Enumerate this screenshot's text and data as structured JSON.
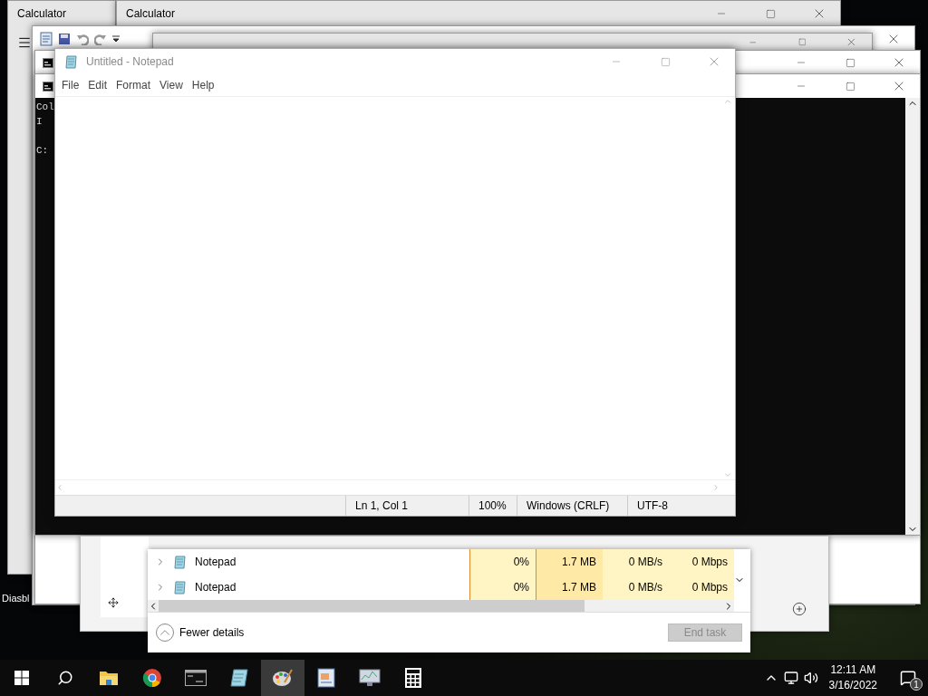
{
  "desktop": {
    "icon_label": "Diasbl"
  },
  "back_windows": [
    {
      "kind": "calculator",
      "title": "Calculator"
    },
    {
      "kind": "calculator",
      "title": "Calculator"
    },
    {
      "kind": "wordpad"
    },
    {
      "kind": "calculator"
    },
    {
      "kind": "console"
    },
    {
      "kind": "console",
      "lines": [
        "Col",
        "I"
      ],
      "prompt": "C:"
    }
  ],
  "task_manager": {
    "rows": [
      {
        "name": "Notepad",
        "cpu": "0%",
        "memory": "1.7 MB",
        "disk": "0 MB/s",
        "network": "0 Mbps"
      },
      {
        "name": "Notepad",
        "cpu": "0%",
        "memory": "1.7 MB",
        "disk": "0 MB/s",
        "network": "0 Mbps"
      }
    ],
    "details_toggle": "Fewer details",
    "end_task": {
      "label": "End task",
      "disabled": true
    }
  },
  "notepad": {
    "title": "Untitled - Notepad",
    "active": false,
    "menu": [
      "File",
      "Edit",
      "Format",
      "View",
      "Help"
    ],
    "status": [
      "Ln 1, Col 1",
      "100%",
      "Windows (CRLF)",
      "UTF-8"
    ]
  },
  "taskbar": {
    "apps": [
      {
        "kind": "explorer",
        "selected": false
      },
      {
        "kind": "chrome",
        "selected": false
      },
      {
        "kind": "console",
        "selected": false
      },
      {
        "kind": "notepad",
        "selected": false
      },
      {
        "kind": "paint",
        "selected": true
      },
      {
        "kind": "wordpad",
        "selected": false
      },
      {
        "kind": "monitor",
        "selected": false
      },
      {
        "kind": "calculator",
        "selected": false
      }
    ],
    "time": "12:11 AM",
    "date": "3/16/2022",
    "notifications": "1"
  }
}
